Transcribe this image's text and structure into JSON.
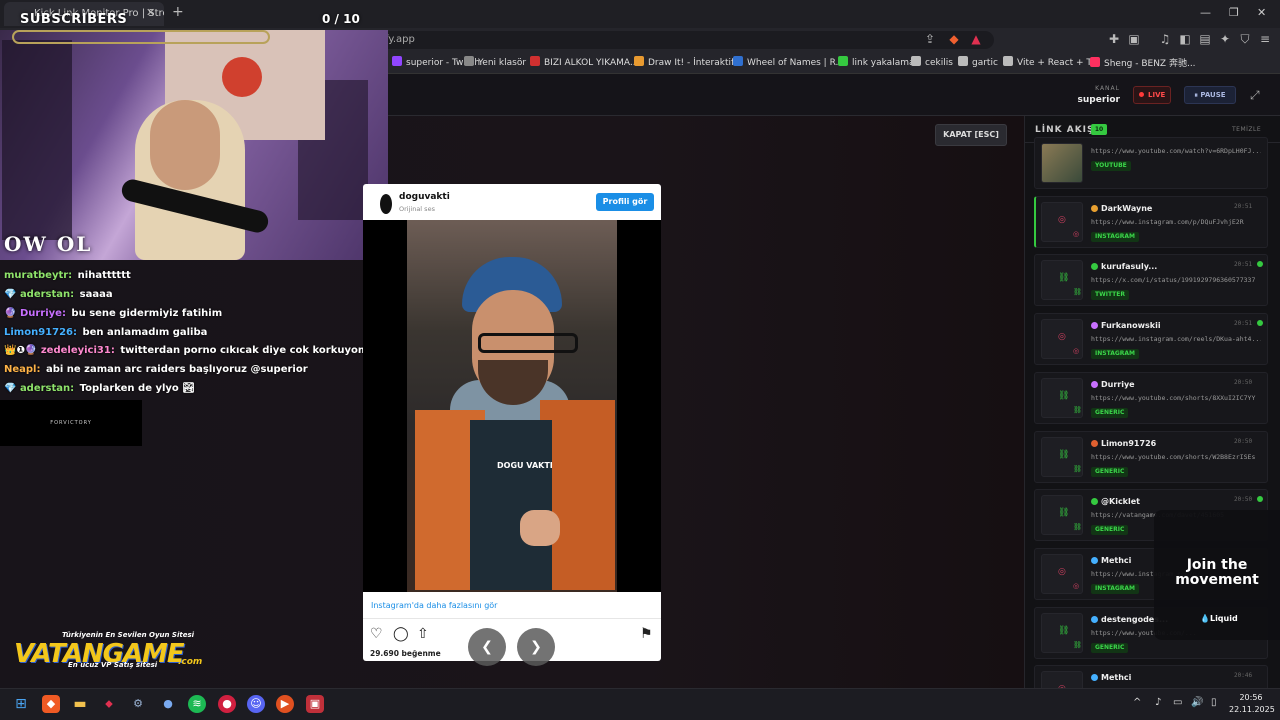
{
  "browser": {
    "tab_title": "Kick Link Monitor Pro | Stream",
    "url": "linkyakalama.netlify.app",
    "bookmarks": [
      {
        "label": "superior - Twitch",
        "color": "#9146ff"
      },
      {
        "label": "Yeni klasör",
        "color": "#888888"
      },
      {
        "label": "BIZI ALKOL YIKAMA...",
        "color": "#d03030"
      },
      {
        "label": "Draw It! - İnteraktif...",
        "color": "#e89a30"
      },
      {
        "label": "Wheel of Names | R...",
        "color": "#3070d0"
      },
      {
        "label": "link yakalama",
        "color": "#35c940"
      },
      {
        "label": "cekilis",
        "color": "#bbbbbb"
      },
      {
        "label": "gartic",
        "color": "#bbbbbb"
      },
      {
        "label": "Vite + React + TS",
        "color": "#bbbbbb"
      },
      {
        "label": "Sheng - BENZ 奔驰...",
        "color": "#ff3060"
      }
    ]
  },
  "overlay": {
    "subscribers_label": "SUBSCRIBERS",
    "subscribers_count": "0  / 10",
    "subscribers_progress": 0,
    "webcam_text": "OW OL",
    "forvictory": "FORVICTORY",
    "chat": [
      {
        "user": "muratbeytr:",
        "user_color": "#8fe36b",
        "message": "nihatttttt",
        "badge": ""
      },
      {
        "user": "aderstan:",
        "user_color": "#8fe36b",
        "message": "saaaa",
        "badge": "💎"
      },
      {
        "user": "Durriye:",
        "user_color": "#c870ff",
        "message": "bu sene gidermiyiz fatihim",
        "badge": "🔮"
      },
      {
        "user": "Limon91726:",
        "user_color": "#45b0ff",
        "message": "ben anlamadım galiba",
        "badge": ""
      },
      {
        "user": "zedeleyici31:",
        "user_color": "#ff8ad0",
        "message": "twitterdan porno cıkıcak diye cok korkuyom",
        "badge": "👑❶🔮"
      },
      {
        "user": "Neapl:",
        "user_color": "#ffb347",
        "message": "abi ne zaman arc raiders başlıyoruz @superior",
        "badge": ""
      },
      {
        "user": "aderstan:",
        "user_color": "#8fe36b",
        "message": "Toplarken de ylyo 🏞",
        "badge": "💎"
      }
    ],
    "sponsor": {
      "tagline": "Türkiyenin En Sevilen Oyun Sitesi",
      "name": "VATANGAME",
      "sub": "En ucuz VP Satış sitesi",
      "com": ".com"
    }
  },
  "header": {
    "kanal_label": "KANAL",
    "kanal_value": "superior",
    "live_label": "LIVE",
    "pause_label": "PAUSE",
    "close_label": "KAPAT [ESC]"
  },
  "instagram": {
    "username": "doguvakti",
    "subtitle": "Orijinal ses",
    "follow_label": "Profili gör",
    "brand_overlay": "DOGU VAKTI",
    "more_label": "Instagram'da daha fazlasını gör",
    "likes": "29.690 beğenme"
  },
  "sidebar": {
    "title": "LİNK AKIŞI",
    "count": "10",
    "clear_label": "TEMİZLE",
    "items": [
      {
        "user": "",
        "url": "https://www.youtube.com/watch?v=6RDpLH0FJ...",
        "tag": "YOUTUBE",
        "time": "",
        "thumb": "video",
        "dot_color": "",
        "active": false,
        "online": false
      },
      {
        "user": "DarkWayne",
        "url": "https://www.instagram.com/p/DQuFJvhjE2R",
        "tag": "INSTAGRAM",
        "time": "20:51",
        "thumb": "instagram",
        "dot_color": "#e8a030",
        "active": true,
        "online": false
      },
      {
        "user": "kurufasuly...",
        "url": "https://x.com/i/status/1991929796360577337",
        "tag": "TWITTER",
        "time": "20:51",
        "thumb": "link",
        "dot_color": "#35c940",
        "active": false,
        "online": true
      },
      {
        "user": "Furkanowskii",
        "url": "https://www.instagram.com/reels/DKua-aht4...",
        "tag": "INSTAGRAM",
        "time": "20:51",
        "thumb": "instagram",
        "dot_color": "#c870ff",
        "active": false,
        "online": true
      },
      {
        "user": "Durriye",
        "url": "https://www.youtube.com/shorts/8XXuI2IC7YY",
        "tag": "GENERIC",
        "time": "20:50",
        "thumb": "link",
        "dot_color": "#c870ff",
        "active": false,
        "online": false
      },
      {
        "user": "Limon91726",
        "url": "https://www.youtube.com/shorts/W2B8EzrISEs",
        "tag": "GENERIC",
        "time": "20:50",
        "thumb": "link",
        "dot_color": "#e06030",
        "active": false,
        "online": false
      },
      {
        "user": "@Kicklet",
        "url": "https://vatangame.com/davet/451605",
        "tag": "GENERIC",
        "time": "20:50",
        "thumb": "link",
        "dot_color": "#35c940",
        "active": false,
        "online": true
      },
      {
        "user": "Methci",
        "url": "https://www.instagram.com/p/...",
        "tag": "INSTAGRAM",
        "time": "",
        "thumb": "instagram",
        "dot_color": "#45b0ff",
        "active": false,
        "online": false
      },
      {
        "user": "destengodes...",
        "url": "https://www.youtube.com/...",
        "tag": "GENERIC",
        "time": "",
        "thumb": "link",
        "dot_color": "#45b0ff",
        "active": false,
        "online": false
      },
      {
        "user": "Methci",
        "url": "https://www.instagram.com/p/DQ353B8jYby",
        "tag": "",
        "time": "20:46",
        "thumb": "instagram",
        "dot_color": "#45b0ff",
        "active": false,
        "online": false
      }
    ]
  },
  "ad": {
    "headline": "Join the movement",
    "brand": "Liquid"
  },
  "taskbar": {
    "time": "20:56",
    "date": "22.11.2025"
  }
}
